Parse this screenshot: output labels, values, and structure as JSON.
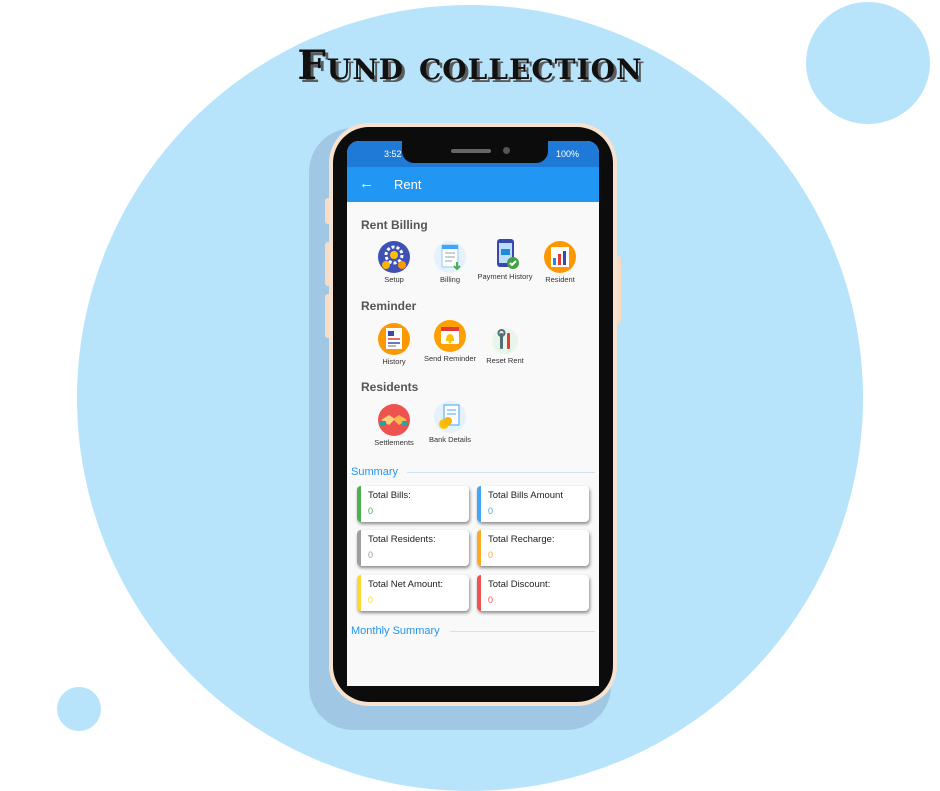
{
  "hero": {
    "title": "Fund collection"
  },
  "status": {
    "time": "3:52",
    "battery": "100%"
  },
  "appbar": {
    "title": "Rent",
    "back_icon": "arrow-left-icon"
  },
  "sections": {
    "rent_billing": {
      "title": "Rent Billing",
      "items": [
        {
          "label": "Setup",
          "icon": "gear-coin-icon"
        },
        {
          "label": "Billing",
          "icon": "invoice-icon"
        },
        {
          "label": "Payment History",
          "icon": "phone-payment-icon"
        },
        {
          "label": "Resident",
          "icon": "resident-chart-icon"
        }
      ]
    },
    "reminder": {
      "title": "Reminder",
      "items": [
        {
          "label": "History",
          "icon": "history-report-icon"
        },
        {
          "label": "Send Reminder",
          "icon": "calendar-bell-icon"
        },
        {
          "label": "Reset Rent",
          "icon": "tools-icon"
        }
      ]
    },
    "residents": {
      "title": "Residents",
      "items": [
        {
          "label": "Settlements",
          "icon": "handshake-icon"
        },
        {
          "label": "Bank Details",
          "icon": "bank-document-icon"
        }
      ]
    }
  },
  "summary": {
    "title": "Summary",
    "cards": [
      {
        "label": "Total Bills:",
        "value": "0",
        "color": "#4caf50"
      },
      {
        "label": "Total Bills Amount",
        "value": "0",
        "color": "#42a5f5"
      },
      {
        "label": "Total Residents:",
        "value": "0",
        "color": "#9e9e9e"
      },
      {
        "label": "Total Recharge:",
        "value": "0",
        "color": "#ffa726"
      },
      {
        "label": "Total Net Amount:",
        "value": "0",
        "color": "#fdd835"
      },
      {
        "label": "Total Discount:",
        "value": "0",
        "color": "#ef5350"
      }
    ]
  },
  "monthly_summary": {
    "title": "Monthly Summary"
  }
}
